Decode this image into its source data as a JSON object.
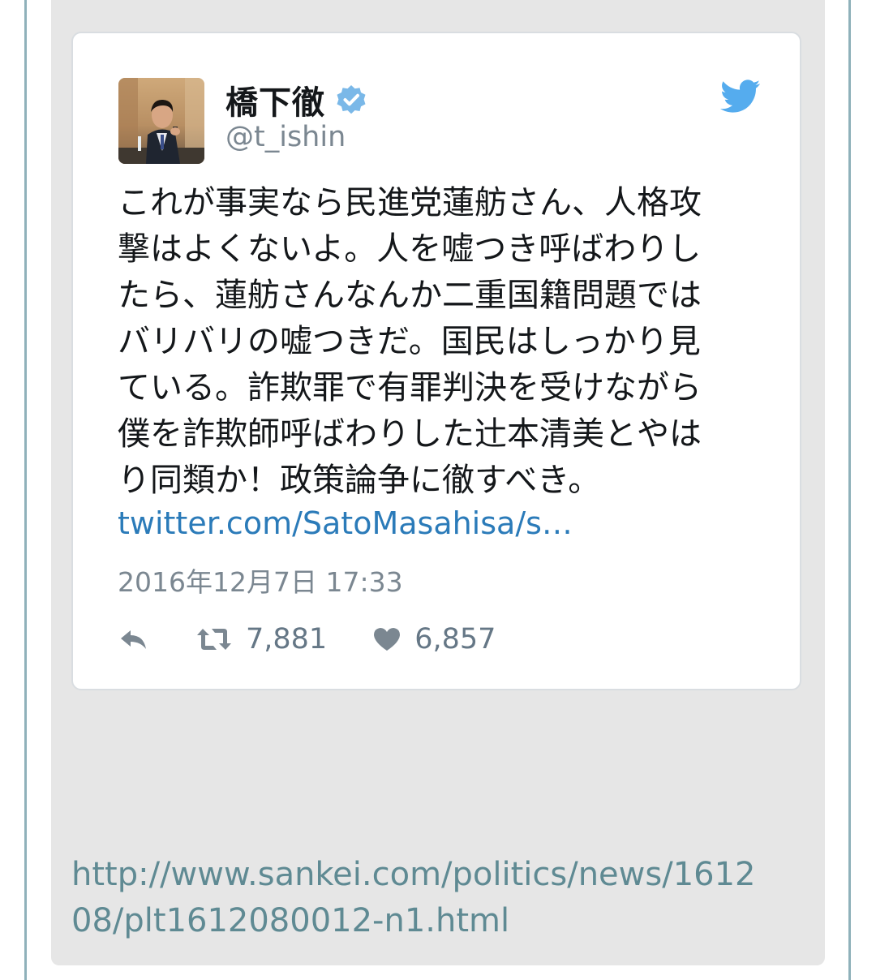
{
  "tweet": {
    "display_name": "橋下徹",
    "handle": "@t_ishin",
    "text_lines": [
      "これが事実なら民進党蓮舫さん、人格攻",
      "撃はよくないよ。人を嘘つき呼ばわりし",
      "たら、蓮舫さんなんか二重国籍問題では",
      "バリバリの嘘つきだ。国民はしっかり見",
      "ている。詐欺罪で有罪判決を受けながら",
      "僕を詐欺師呼ばわりした辻本清美とやは",
      "り同類か！政策論争に徹すべき。"
    ],
    "link": "twitter.com/SatoMasahisa/s…",
    "timestamp": "2016年12月7日 17:33",
    "retweet_count": "7,881",
    "like_count": "6,857"
  },
  "source_url_lines": [
    "http://www.sankei.com/politics/news/1612",
    "08/plt1612080012-n1.html"
  ],
  "colors": {
    "panel_bg": "#e6e6e6",
    "verified_blue": "#7ab8e8",
    "twitter_blue": "#55acee",
    "link_blue": "#2b7bb9",
    "source_link": "#5f8a93"
  },
  "icons": [
    "verified-badge-icon",
    "twitter-bird-icon",
    "reply-icon",
    "retweet-icon",
    "heart-icon"
  ]
}
